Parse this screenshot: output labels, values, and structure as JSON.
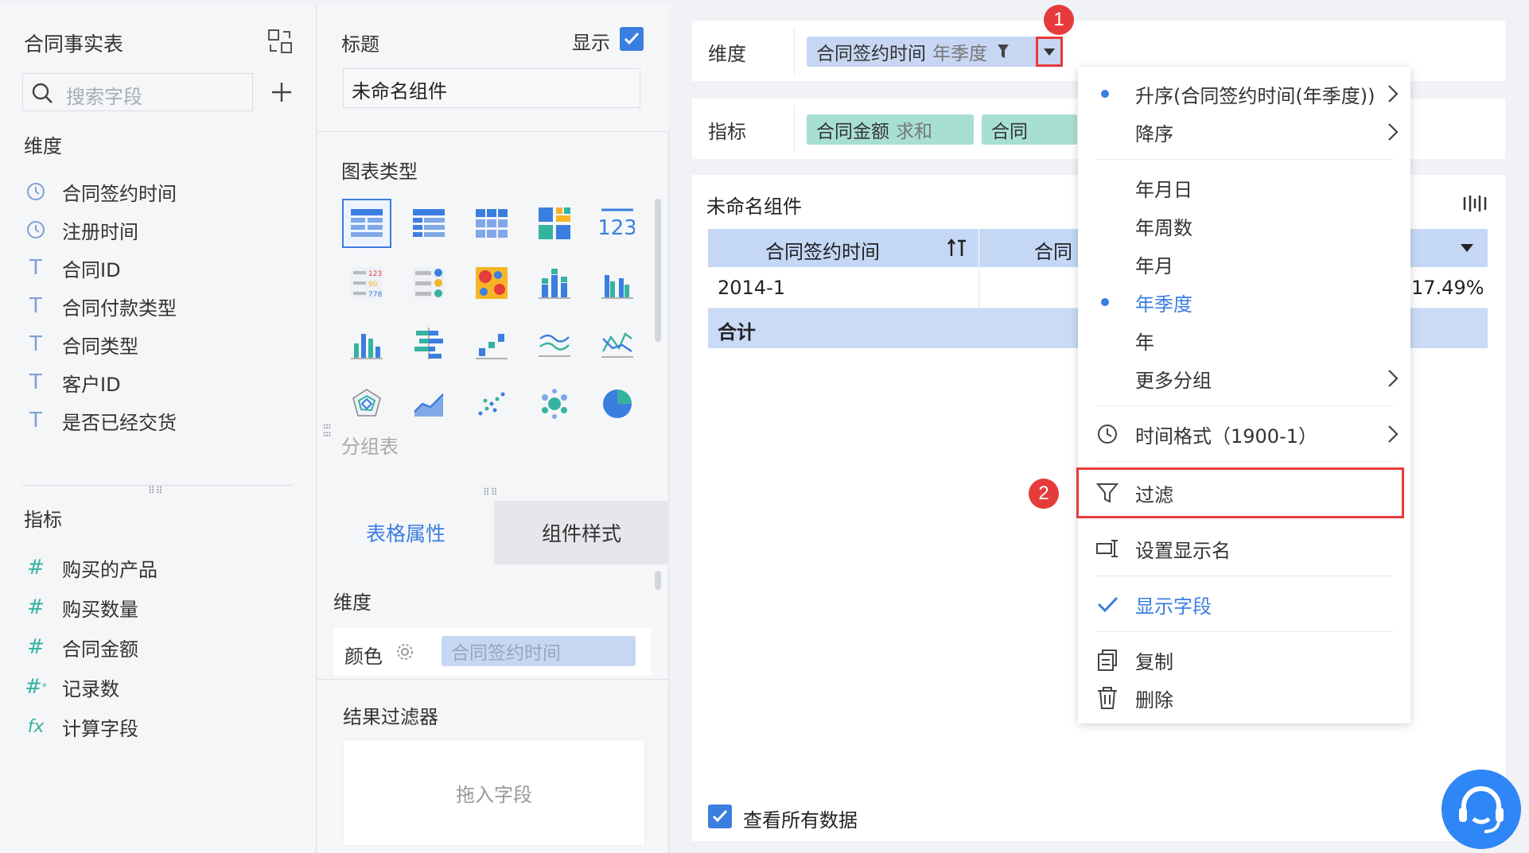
{
  "left_panel": {
    "title": "合同事实表",
    "search_placeholder": "搜索字段",
    "dimension_header": "维度",
    "dimensions": [
      {
        "icon": "clock-icon",
        "label": "合同签约时间"
      },
      {
        "icon": "clock-icon",
        "label": "注册时间"
      },
      {
        "icon": "text-type-icon",
        "label": "合同ID"
      },
      {
        "icon": "text-type-icon",
        "label": "合同付款类型"
      },
      {
        "icon": "text-type-icon",
        "label": "合同类型"
      },
      {
        "icon": "text-type-icon",
        "label": "客户ID"
      },
      {
        "icon": "text-type-icon",
        "label": "是否已经交货"
      }
    ],
    "metric_header": "指标",
    "metrics": [
      {
        "icon": "number-type-icon",
        "label": "购买的产品"
      },
      {
        "icon": "number-type-icon",
        "label": "购买数量"
      },
      {
        "icon": "number-type-icon",
        "label": "合同金额"
      },
      {
        "icon": "record-count-icon",
        "label": "记录数"
      },
      {
        "icon": "formula-icon",
        "label": "计算字段"
      }
    ]
  },
  "middle_panel": {
    "title_label": "标题",
    "show_label": "显示",
    "title_value": "未命名组件",
    "chart_type_label": "图表类型",
    "chart_type_hint": "分组表",
    "tabs": [
      "表格属性",
      "组件样式"
    ],
    "property_dimension_label": "维度",
    "color_label": "颜色",
    "color_field": "合同签约时间",
    "result_filter_label": "结果过滤器",
    "drop_hint": "拖入字段"
  },
  "right_area": {
    "dimension_label": "维度",
    "dimension_pill": {
      "name": "合同签约时间",
      "suffix": "年季度"
    },
    "metric_label": "指标",
    "metric_pills": [
      {
        "name": "合同金额",
        "suffix": "求和"
      },
      {
        "name": "合同",
        "suffix": ""
      }
    ],
    "widget_title": "未命名组件",
    "table": {
      "headers": [
        "合同签约时间",
        "合同"
      ],
      "rows": [
        [
          "2014-1",
          "",
          "17.49%"
        ]
      ],
      "total_label": "合计"
    },
    "view_all_label": "查看所有数据"
  },
  "dropdown_menu": {
    "sort_items": [
      "升序(合同签约时间(年季度))",
      "降序"
    ],
    "group_items": [
      "年月日",
      "年周数",
      "年月",
      "年季度",
      "年",
      "更多分组"
    ],
    "selected_group": "年季度",
    "time_format": "时间格式（1900-1）",
    "filter": "过滤",
    "set_display_name": "设置显示名",
    "show_field": "显示字段",
    "copy": "复制",
    "delete": "删除"
  },
  "annotations": {
    "step1": "1",
    "step2": "2"
  },
  "colors": {
    "accent": "#3a7ee0",
    "dimension_pill": "#c7d6f3",
    "metric_pill": "#a8dfd3",
    "highlight_box": "#e63b3b",
    "metric_icon": "#35b3a1"
  }
}
